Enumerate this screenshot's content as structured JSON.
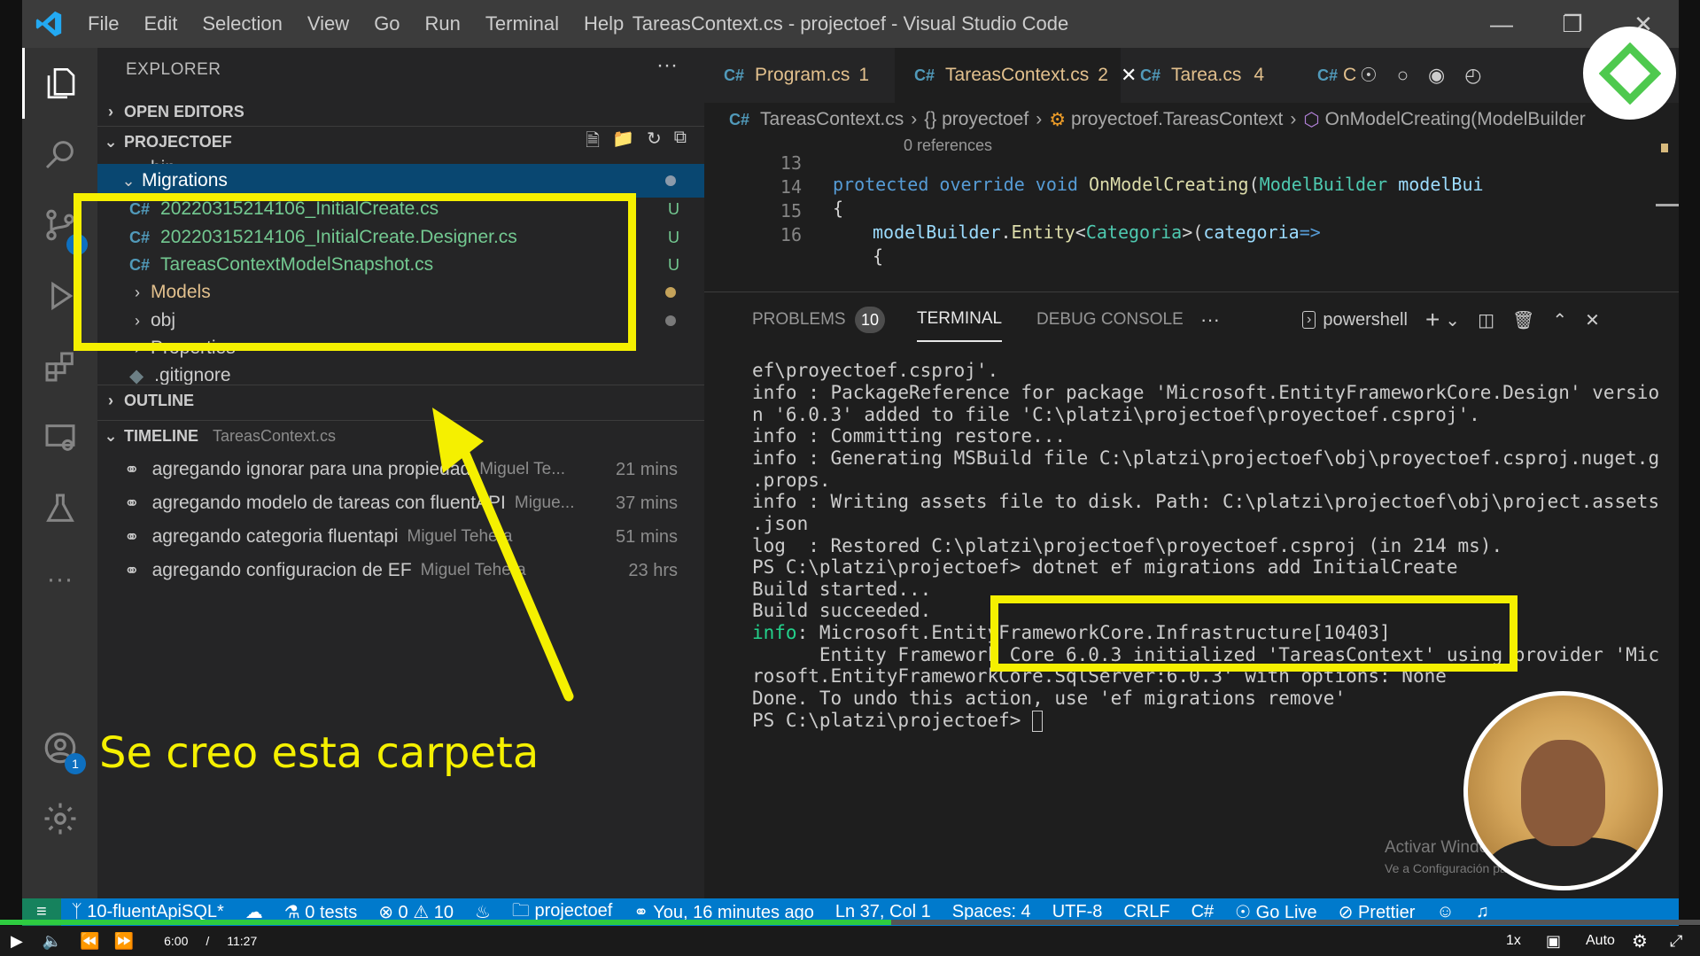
{
  "titlebar": {
    "menu": [
      "File",
      "Edit",
      "Selection",
      "View",
      "Go",
      "Run",
      "Terminal",
      "Help"
    ],
    "title": "TareasContext.cs - projectoef - Visual Studio Code"
  },
  "activity": {
    "scm_badge": "6",
    "accounts_badge": "1"
  },
  "sidebar": {
    "header": "EXPLORER",
    "more": "···",
    "open_editors": "OPEN EDITORS",
    "project": "PROJECTOEF",
    "tree": {
      "bin": "bin",
      "migrations": "Migrations",
      "file1": "20220315214106_InitialCreate.cs",
      "file2": "20220315214106_InitialCreate.Designer.cs",
      "file3": "TareasContextModelSnapshot.cs",
      "models": "Models",
      "obj": "obj",
      "properties": "Properties",
      "gitignore": ".gitignore",
      "untracked": "U"
    },
    "outline": "OUTLINE",
    "timeline": "TIMELINE",
    "timeline_file": "TareasContext.cs",
    "timeline_items": [
      {
        "msg": "agregando ignorar para una propiedad",
        "author": "Miguel Te...",
        "time": "21 mins"
      },
      {
        "msg": "agregando modelo de tareas con fluentAPI",
        "author": "Migue...",
        "time": "37 mins"
      },
      {
        "msg": "agregando categoria fluentapi",
        "author": "Miguel Tehera",
        "time": "51 mins"
      },
      {
        "msg": "agregando configuracion de EF",
        "author": "Miguel Tehera",
        "time": "23 hrs"
      }
    ]
  },
  "editor": {
    "tabs": [
      {
        "label": "Program.cs",
        "count": "1"
      },
      {
        "label": "TareasContext.cs",
        "count": "2"
      },
      {
        "label": "Tarea.cs",
        "count": "4"
      },
      {
        "label": "C"
      }
    ],
    "breadcrumb": [
      "TareasContext.cs",
      "{} proyectoef",
      "proyectoef.TareasContext",
      "OnModelCreating(ModelBuilder"
    ],
    "references": "0 references",
    "lines": [
      {
        "n": "13"
      },
      {
        "n": "14"
      },
      {
        "n": "15"
      },
      {
        "n": "16"
      }
    ],
    "code": {
      "l13_kw": "protected override void ",
      "l13_fn": "OnModelCreating",
      "l13_p": "(",
      "l13_ty": "ModelBuilder",
      "l13_id": " modelBui",
      "l14": "{",
      "l15_a": "modelBuilder",
      "l15_b": ".",
      "l15_c": "Entity",
      "l15_d": "<",
      "l15_e": "Categoria",
      "l15_f": ">(",
      "l15_g": "categoria",
      "l15_h": "=>",
      "l16": "{"
    }
  },
  "panel": {
    "problems": "PROBLEMS",
    "problems_count": "10",
    "terminal": "TERMINAL",
    "debug": "DEBUG CONSOLE",
    "more": "···",
    "shell": "powershell",
    "lines": [
      "ef\\proyectoef.csproj'.",
      "info : PackageReference for package 'Microsoft.EntityFrameworkCore.Design' versio",
      "n '6.0.3' added to file 'C:\\platzi\\projectoef\\proyectoef.csproj'.",
      "info : Committing restore...",
      "info : Generating MSBuild file C:\\platzi\\projectoef\\obj\\proyectoef.csproj.nuget.g",
      ".props.",
      "info : Writing assets file to disk. Path: C:\\platzi\\projectoef\\obj\\project.assets",
      ".json",
      "log  : Restored C:\\platzi\\projectoef\\proyectoef.csproj (in 214 ms).",
      "PS C:\\platzi\\projectoef> dotnet ef migrations add InitialCreate",
      "Build started...",
      "Build succeeded.",
      "info: Microsoft.EntityFrameworkCore.Infrastructure[10403]",
      "      Entity Framework Core 6.0.3 initialized 'TareasContext' using provider 'Mic",
      "rosoft.EntityFrameworkCore.SqlServer:6.0.3' with options: None",
      "Done. To undo this action, use 'ef migrations remove'",
      "PS C:\\platzi\\projectoef> "
    ]
  },
  "statusbar": {
    "branch": "10-fluentApiSQL*",
    "tests": "0 tests",
    "errors": "0",
    "warnings": "10",
    "project": "projectoef",
    "blame": "You, 16 minutes ago",
    "position": "Ln 37, Col 1",
    "spaces": "Spaces: 4",
    "encoding": "UTF-8",
    "eol": "CRLF",
    "lang": "C#",
    "golive": "Go Live",
    "prettier": "Prettier"
  },
  "annotation": {
    "caption": "Se creo esta carpeta",
    "color": "#f5f000"
  },
  "watermark": {
    "line1": "Activar Windows",
    "line2": "Ve a Configuración para activar Windows."
  },
  "player": {
    "current": "6:00",
    "sep": "/",
    "total": "11:27",
    "progress": 0.524,
    "speed": "1x",
    "quality": "Auto"
  }
}
